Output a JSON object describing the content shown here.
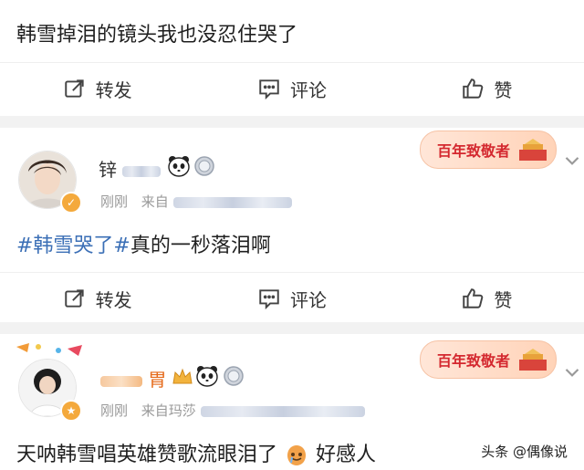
{
  "post0": {
    "text": "韩雪掉泪的镜头我也没忍住哭了",
    "actions": {
      "repost": "转发",
      "comment": "评论",
      "like": "赞"
    }
  },
  "post1": {
    "username": "锌",
    "time": "刚刚",
    "source_prefix": "来自",
    "hashtag": "#韩雪哭了#",
    "text": "真的一秒落泪啊",
    "badge": "百年致敬者",
    "actions": {
      "repost": "转发",
      "comment": "评论",
      "like": "赞"
    }
  },
  "post2": {
    "username": "胃",
    "time": "刚刚",
    "source_prefix": "来自玛莎",
    "text": "天呐韩雪唱英雄赞歌流眼泪了",
    "text_tail": "好感人",
    "badge": "百年致敬者"
  },
  "watermark": "头条 @偶像说",
  "colors": {
    "hashtag": "#3b6fb6",
    "badge": "#d4282f",
    "background": "#f2f2f2"
  }
}
